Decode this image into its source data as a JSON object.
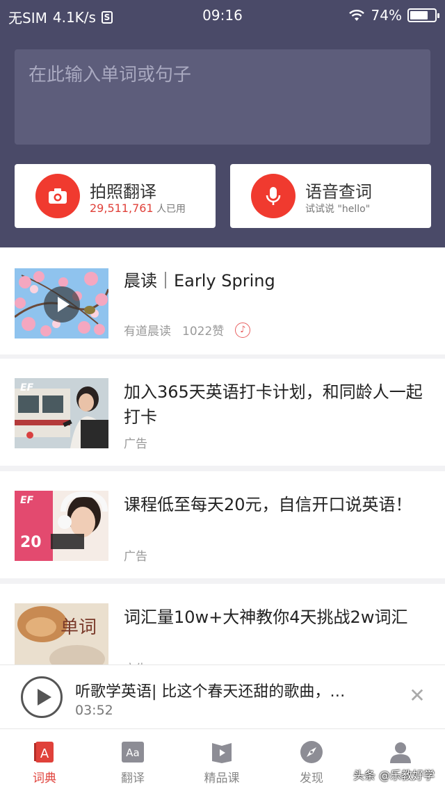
{
  "status_bar": {
    "carrier": "无SIM",
    "speed": "4.1K/s",
    "s_icon": "S",
    "time": "09:16",
    "battery": "74%",
    "battery_level": 0.74
  },
  "search": {
    "placeholder": "在此输入单词或句子"
  },
  "quick_actions": [
    {
      "title": "拍照翻译",
      "count": "29,511,761",
      "suffix": "人已用",
      "icon": "camera-icon"
    },
    {
      "title": "语音查词",
      "subtitle": "试试说 \"hello\"",
      "icon": "microphone-icon"
    }
  ],
  "feed": [
    {
      "title": "晨读｜Early Spring",
      "source": "有道晨读",
      "likes": "1022赞"
    },
    {
      "title": "加入365天英语打卡计划，和同龄人一起打卡",
      "tag": "广告",
      "thumb_text": "EF"
    },
    {
      "title": "课程低至每天20元，自信开口说英语！",
      "tag": "广告",
      "thumb_text": "EF",
      "thumb_price": "20"
    },
    {
      "title": "词汇量10w+大神教你4天挑战2w词汇",
      "tag": "广告",
      "thumb_text": "单词"
    }
  ],
  "player": {
    "title": "听歌学英语| 比这个春天还甜的歌曲，…",
    "time": "03:52"
  },
  "tabs": [
    {
      "label": "词典",
      "icon": "dictionary-icon",
      "active": true
    },
    {
      "label": "翻译",
      "icon": "translate-icon"
    },
    {
      "label": "精品课",
      "icon": "course-icon"
    },
    {
      "label": "发现",
      "icon": "compass-icon"
    },
    {
      "label": "",
      "icon": "profile-icon"
    }
  ],
  "watermark": "头条 @乐教好学",
  "colors": {
    "header": "#4a4a68",
    "accent": "#f03a2f"
  }
}
